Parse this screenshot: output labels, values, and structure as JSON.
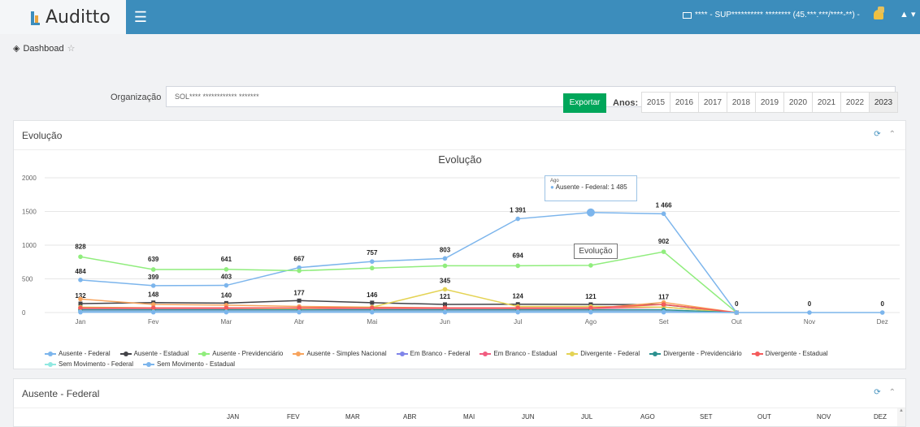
{
  "app": {
    "name": "Auditto",
    "org_switcher": "**** - SUP********** ******** (45.***.***/****-**) -"
  },
  "breadcrumb": {
    "label": "Dashboad"
  },
  "filters": {
    "org_label": "Organização",
    "org_value": "SOL**** ************ *******",
    "export_label": "Exportar",
    "years_label": "Anos:",
    "years": [
      "2015",
      "2016",
      "2017",
      "2018",
      "2019",
      "2020",
      "2021",
      "2022",
      "2023"
    ],
    "active_year": "2023"
  },
  "panel1": {
    "title": "Evolução",
    "refresh_icon": "refresh-icon",
    "collapse_icon": "chevron-up-icon"
  },
  "panel2": {
    "title": "Ausente - Federal",
    "months": [
      "JAN",
      "FEV",
      "MAR",
      "ABR",
      "MAI",
      "JUN",
      "JUL",
      "AGO",
      "SET",
      "OUT",
      "NOV",
      "DEZ"
    ]
  },
  "tooltip": {
    "month": "Ago",
    "text": "Ausente - Federal: 1 485"
  },
  "hover_label": "Evolução",
  "chart_data": {
    "type": "line",
    "title": "Evolução",
    "categories": [
      "Jan",
      "Fev",
      "Mar",
      "Abr",
      "Mai",
      "Jun",
      "Jul",
      "Ago",
      "Set",
      "Out",
      "Nov",
      "Dez"
    ],
    "ylim": [
      0,
      2000
    ],
    "yticks": [
      0,
      500,
      1000,
      1500,
      2000
    ],
    "grid": true,
    "legend_position": "bottom",
    "series": [
      {
        "name": "Ausente - Federal",
        "color": "#7cb5ec",
        "values": [
          484,
          399,
          403,
          667,
          757,
          803,
          1391,
          1485,
          1466,
          0,
          0,
          0
        ],
        "labels": [
          "484",
          "399",
          "403",
          "667",
          "757",
          "803",
          "1 391",
          "",
          "1 466",
          "0",
          "0",
          "0"
        ]
      },
      {
        "name": "Ausente - Estadual",
        "color": "#434348",
        "values": [
          132,
          148,
          140,
          177,
          146,
          121,
          124,
          121,
          117,
          0,
          null,
          null
        ],
        "labels": [
          "132",
          "148",
          "140",
          "177",
          "146",
          "121",
          "124",
          "121",
          "117",
          "",
          "",
          ""
        ]
      },
      {
        "name": "Ausente - Previdenciário",
        "color": "#90ed7d",
        "values": [
          828,
          639,
          641,
          620,
          660,
          694,
          694,
          700,
          902,
          0,
          null,
          null
        ],
        "labels": [
          "828",
          "639",
          "641",
          "",
          "",
          "",
          "694",
          "",
          "902",
          "",
          "",
          ""
        ]
      },
      {
        "name": "Ausente - Simples Nacional",
        "color": "#f7a35c",
        "values": [
          200,
          120,
          110,
          90,
          80,
          70,
          60,
          60,
          150,
          0,
          null,
          null
        ]
      },
      {
        "name": "Em Branco - Federal",
        "color": "#8085e9",
        "values": [
          20,
          20,
          20,
          20,
          20,
          20,
          20,
          20,
          20,
          0,
          null,
          null
        ]
      },
      {
        "name": "Em Branco - Estadual",
        "color": "#f15c80",
        "values": [
          60,
          60,
          60,
          60,
          60,
          60,
          60,
          60,
          80,
          0,
          null,
          null
        ]
      },
      {
        "name": "Divergente - Federal",
        "color": "#e4d354",
        "values": [
          80,
          70,
          70,
          60,
          80,
          345,
          90,
          90,
          80,
          0,
          null,
          null
        ],
        "labels": [
          "",
          "",
          "",
          "",
          "",
          "345",
          "",
          "",
          "",
          "",
          "",
          ""
        ]
      },
      {
        "name": "Divergente - Previdenciário",
        "color": "#2b908f",
        "values": [
          40,
          40,
          40,
          40,
          40,
          40,
          40,
          40,
          40,
          0,
          null,
          null
        ]
      },
      {
        "name": "Divergente - Estadual",
        "color": "#f45b5b",
        "values": [
          70,
          70,
          70,
          70,
          70,
          70,
          70,
          70,
          120,
          0,
          null,
          null
        ]
      },
      {
        "name": "Sem Movimento - Federal",
        "color": "#91e8e1",
        "values": [
          10,
          10,
          10,
          10,
          10,
          10,
          10,
          10,
          10,
          0,
          null,
          null
        ]
      },
      {
        "name": "Sem Movimento - Estadual",
        "color": "#7cb5ec",
        "values": [
          5,
          5,
          5,
          5,
          5,
          5,
          5,
          5,
          5,
          0,
          null,
          null
        ]
      }
    ]
  }
}
